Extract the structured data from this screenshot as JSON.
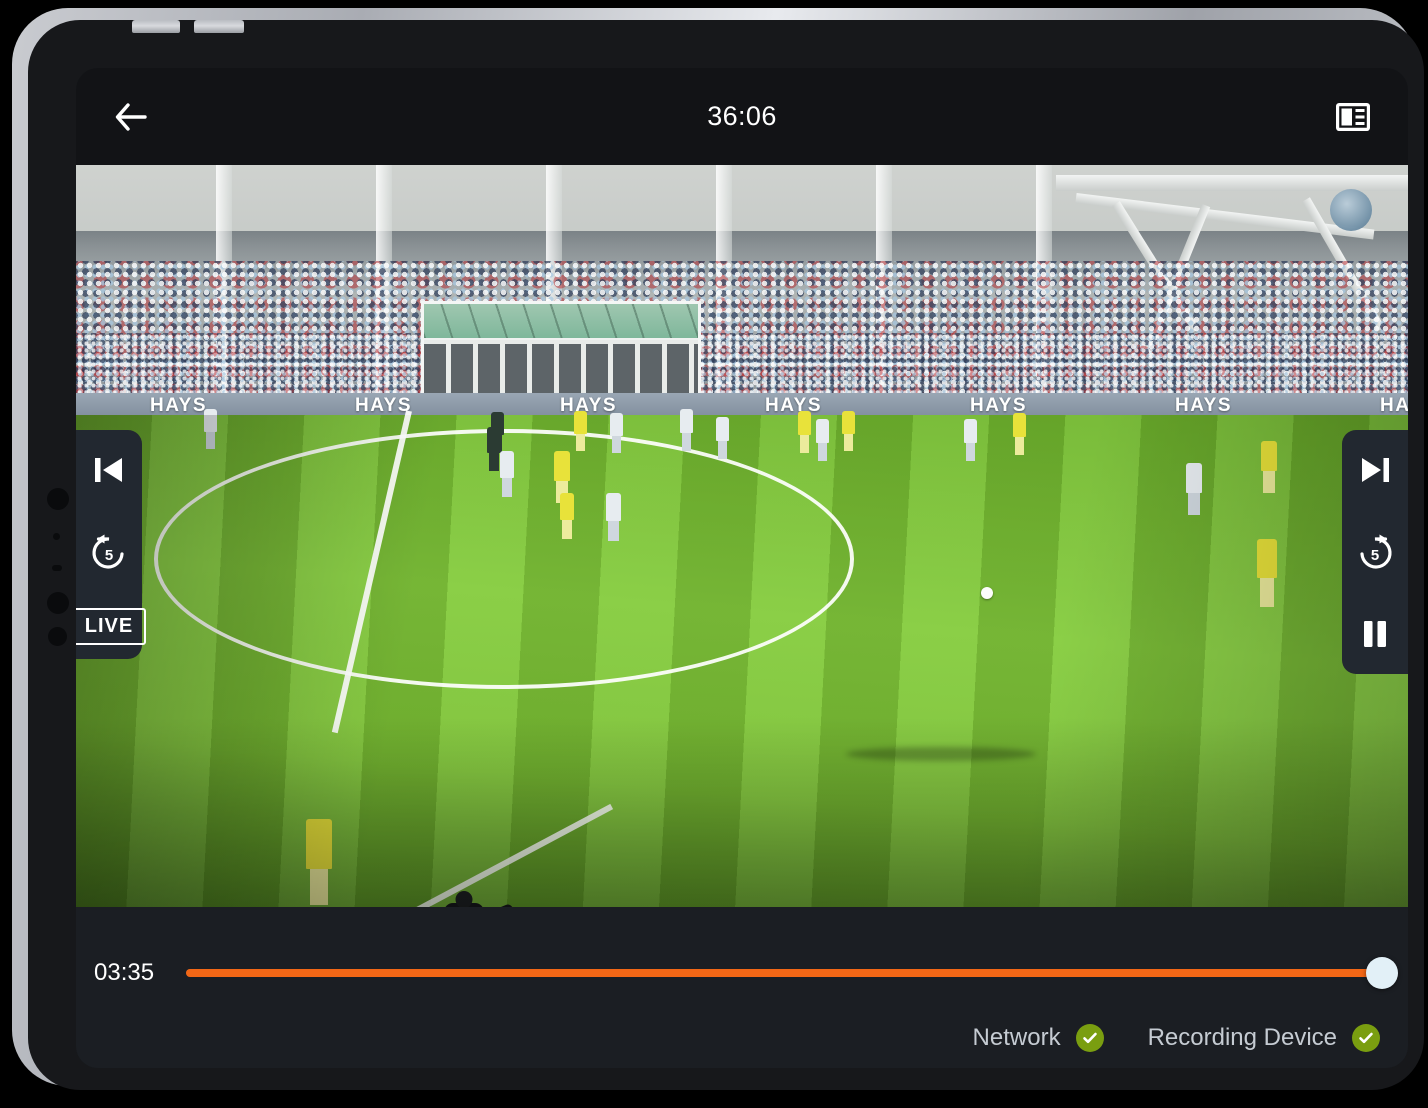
{
  "app": {
    "topbar": {
      "back_icon": "arrow-left-icon",
      "title": "36:06",
      "panel_toggle_icon": "sidebar-panel-icon"
    },
    "player_controls": {
      "left": {
        "skip_to_start_icon": "skip-to-start-icon",
        "rewind_label": "5",
        "rewind_icon": "rewind-5-icon",
        "live_label": "LIVE"
      },
      "right": {
        "skip_to_end_icon": "skip-to-end-icon",
        "forward_label": "5",
        "forward_icon": "forward-5-icon",
        "pause_icon": "pause-icon"
      }
    },
    "seek": {
      "elapsed": "03:35",
      "progress_percent": 100,
      "fill_color": "#f26716",
      "thumb_color": "#e2f0f7"
    },
    "status": {
      "items": [
        {
          "label": "Network",
          "state": "ok",
          "icon": "check-circle-icon"
        },
        {
          "label": "Recording Device",
          "state": "ok",
          "icon": "check-circle-icon"
        }
      ],
      "ok_color": "#7a9e10"
    },
    "video": {
      "scene": "football-match-live",
      "advert_boards": [
        "HAYS",
        "HAYS",
        "HAYS",
        "HAYS",
        "HAYS",
        "HAYS",
        "HAYS"
      ],
      "pitch_color": "#7cc234"
    }
  }
}
